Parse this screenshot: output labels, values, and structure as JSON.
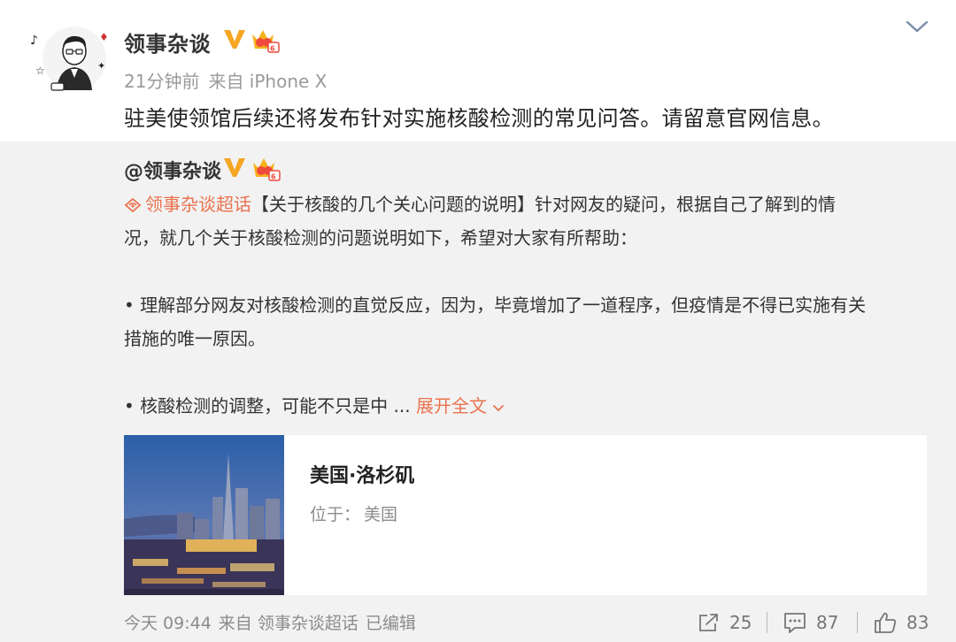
{
  "post": {
    "author": "领事杂谈",
    "time": "21分钟前",
    "source": "来自 iPhone X",
    "text": "驻美使领馆后续还将发布针对实施核酸检测的常见问答。请留意官网信息。"
  },
  "repost": {
    "author": "@领事杂谈",
    "topic": "领事杂谈超话",
    "line1_rest": "【关于核酸的几个关心问题的说明】针对网友的疑问，根据自己了解到的情",
    "line2": "况，就几个关于核酸检测的问题说明如下，希望对大家有所帮助：",
    "bullet1_line1": "• 理解部分网友对核酸检测的直觉反应，因为，毕竟增加了一道程序，但疫情是不得已实施有关",
    "bullet1_line2": "措施的唯一原因。",
    "bullet2_prefix": "• 核酸检测的调整，可能不只是中 ... ",
    "expand_label": "展开全文",
    "card": {
      "title": "美国·洛杉矶",
      "sub_label": "位于：",
      "sub_value": "美国"
    },
    "footer": {
      "date": "今天 09:44",
      "source": "来自 领事杂谈超话",
      "edited": "已编辑",
      "reposts": "25",
      "comments": "87",
      "likes": "83"
    }
  },
  "colors": {
    "accent_orange": "#eb7350",
    "repost_bg": "#f2f2f2",
    "verified_gold": "#f5a623"
  },
  "icons": [
    "v-verified-icon",
    "member-crown-icon",
    "chevron-down-icon",
    "supertopic-icon",
    "repost-icon",
    "comment-icon",
    "like-icon"
  ]
}
